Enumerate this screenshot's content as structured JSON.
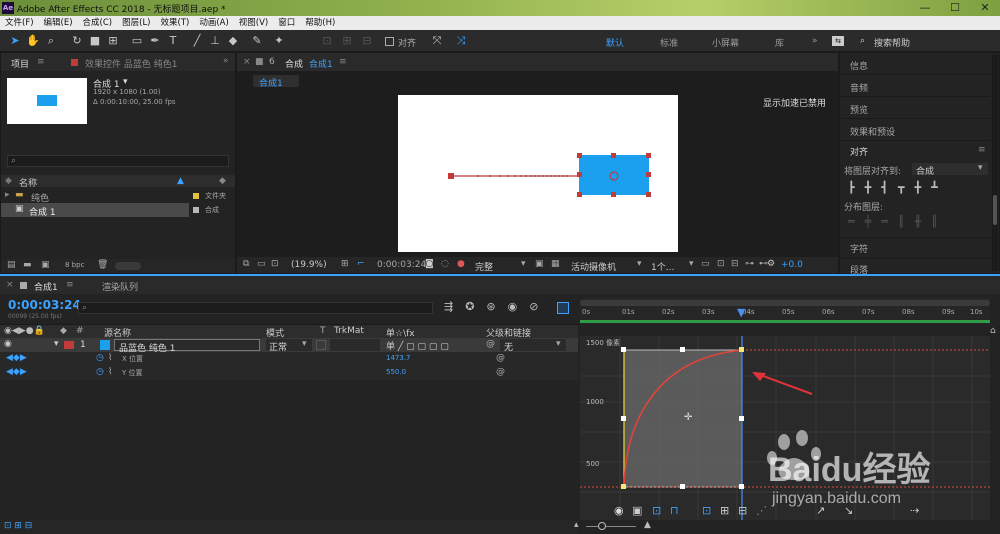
{
  "window": {
    "title": "Adobe After Effects CC 2018 - 无标题项目.aep *",
    "app_icon": "Ae"
  },
  "menu": [
    "文件(F)",
    "编辑(E)",
    "合成(C)",
    "图层(L)",
    "效果(T)",
    "动画(A)",
    "视图(V)",
    "窗口",
    "帮助(H)"
  ],
  "toolbar": {
    "align_label": "对齐",
    "workspaces": [
      "默认",
      "标准",
      "小屏幕",
      "库"
    ],
    "search_placeholder": "搜索帮助"
  },
  "project": {
    "tab": "项目",
    "effects_tab": "效果控件 品蓝色 纯色1",
    "comp_name": "合成 1",
    "comp_size": "1920 x 1080 (1.00)",
    "comp_duration": "Δ 0:00:10:00, 25.00 fps",
    "col_name": "名称",
    "items": [
      {
        "name": "纯色",
        "type": "文件夹"
      },
      {
        "name": "合成 1",
        "type": "合成"
      }
    ],
    "bpc": "8 bpc"
  },
  "viewer": {
    "tab": "合成",
    "comp_tab": "合成1",
    "comp_sub": "合成1",
    "message": "显示加速已禁用",
    "zoom": "(19.9%)",
    "time": "0:00:03:24",
    "quality": "完整",
    "camera": "活动摄像机",
    "view": "1个...",
    "exposure": "+0.0"
  },
  "right_panel": {
    "items": [
      "信息",
      "音频",
      "预览",
      "效果和预设"
    ],
    "align_title": "对齐",
    "align_to_label": "将图层对齐到:",
    "align_to_value": "合成",
    "distribute_label": "分布图层:",
    "char": "字符",
    "para": "段落"
  },
  "timeline": {
    "tab": "合成1",
    "render_tab": "渲染队列",
    "timecode": "0:00:03:24",
    "frame_info": "00099 (25.00 fps)",
    "cols": {
      "source": "源名称",
      "mode": "模式",
      "trkmat": "TrkMat",
      "parent": "父级和链接",
      "switch_icons": "单☆\\fx"
    },
    "layer": {
      "num": "1",
      "name": "品蓝色 纯色 1",
      "mode": "正常",
      "parent": "无"
    },
    "props": [
      {
        "name": "X 位置",
        "value": "1473.7"
      },
      {
        "name": "Y 位置",
        "value": "550.0"
      }
    ],
    "ruler": [
      "0s",
      "01s",
      "02s",
      "03s",
      "04s",
      "05s",
      "06s",
      "07s",
      "08s",
      "09s",
      "10s"
    ],
    "graph_labels": [
      "1500 像素",
      "1000",
      "500"
    ]
  },
  "watermark": {
    "text": "Baidu经验",
    "url": "jingyan.baidu.com"
  },
  "colors": {
    "accent": "#3ba3ff",
    "layer_label": "#c23b3b",
    "solid": "#1aa0ee",
    "curve": "#e0443a",
    "playhead": "#4d8ef0"
  }
}
